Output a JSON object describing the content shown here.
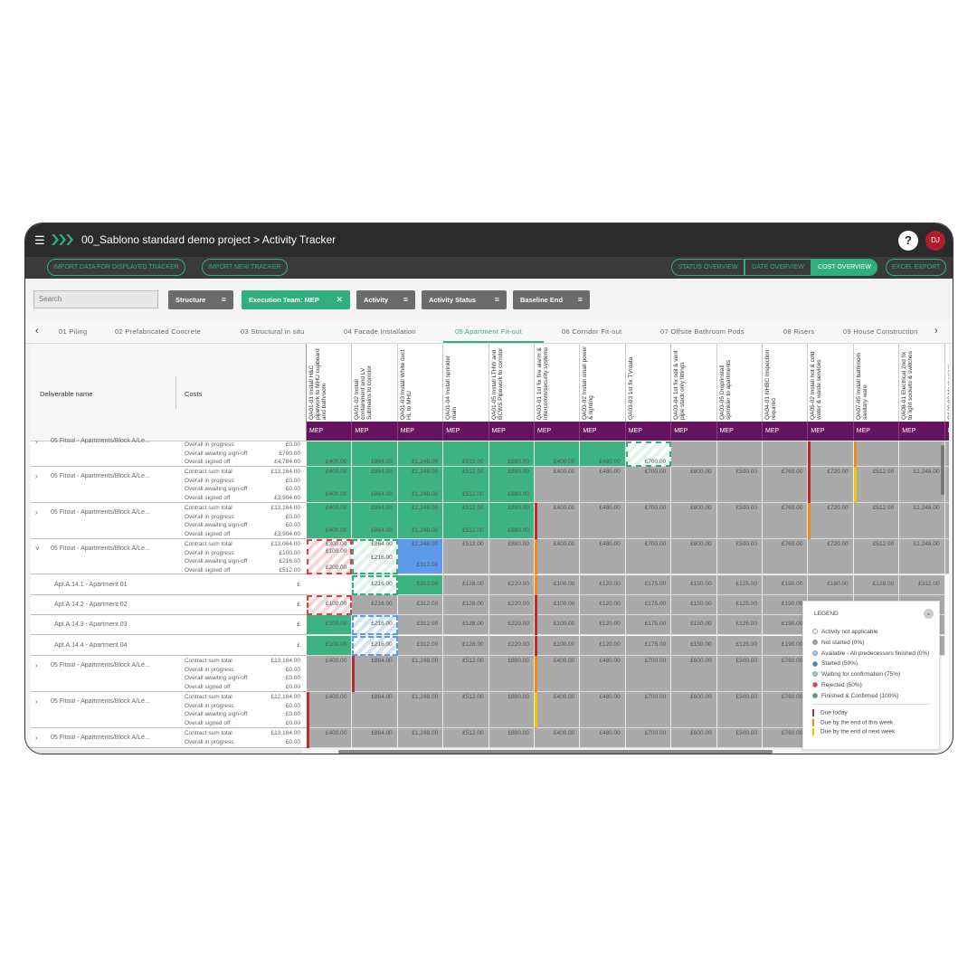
{
  "app": {
    "title": "00_Sablono standard demo project > Activity Tracker",
    "help_label": "?",
    "avatar_initials": "DJ"
  },
  "actions": {
    "import_displayed": "IMPORT DATA FOR DISPLAYED TRACKER",
    "import_new": "IMPORT NEW TRACKER",
    "status_overview": "STATUS OVERVIEW",
    "date_overview": "DATE OVERVIEW",
    "cost_overview": "COST OVERVIEW",
    "excel_export": "EXCEL EXPORT"
  },
  "search": {
    "placeholder": "Search"
  },
  "filters": [
    {
      "label": "Structure",
      "active": false
    },
    {
      "label": "Execution Team: MEP",
      "active": true
    },
    {
      "label": "Activity",
      "active": false
    },
    {
      "label": "Activity Status",
      "active": false
    },
    {
      "label": "Baseline End",
      "active": false
    }
  ],
  "tabs": [
    "01 Piling",
    "02 Prefabricated Concrete",
    "03 Structural in situ",
    "04 Facade Installation",
    "05 Apartment Fit-out",
    "06 Corridor Fit-out",
    "07 Offsite Bathroom Pods",
    "08 Risers",
    "09 House Construction"
  ],
  "active_tab": "05 Apartment Fit-out",
  "grid": {
    "col_deliverable": "Deliverable name",
    "col_costs": "Costs",
    "team": "MEP",
    "columns": [
      "QA01-01 Install H&C pipework to MHU cupboard and bathroom",
      "QA01-02 Install containment and LV Submains to corridor",
      "QA01-03 Install White duct HL to MHU",
      "QA01-04 Install sprinkler main",
      "QA01-05 Install LTHW and BCWS Pipework to corridor",
      "QA03-01 1st fix fire alarm & intercomm/security systems",
      "QA03-02 Install small power & lighting",
      "QA03-03 1st fix TV/data",
      "QA03-04 1st fix soil & vent pipe stack only fittings",
      "QA03-05 Drop/install sprinkler to apartments",
      "QA04-01 NHBC inspection required",
      "QA05-02 Install hot & cold water & waste services",
      "QA07-05 Install bathroom sanitary ware",
      "QA08-01 Electrical 2nd fix to light sockets & switches",
      "QA08-02 Mechanical"
    ],
    "rows": [
      {
        "name": "05 Fitout - Apartments/Block A/Le...",
        "costs": [
          [
            "Overall in progress",
            "£0.00"
          ],
          [
            "Overall awaiting sign-off",
            "£700.00"
          ],
          [
            "Overall signed off",
            "£4,784.00"
          ]
        ],
        "cells": [
          "£400.00",
          "£864.00",
          "£1,248.00",
          "£512.00",
          "£880.00",
          "£400.00",
          "£480.00",
          "£700.00",
          "",
          "",
          "",
          "",
          "",
          "",
          ""
        ]
      },
      {
        "name": "05 Fitout - Apartments/Block A/Le...",
        "costs": [
          [
            "Contract sum total",
            "£13,164.00"
          ],
          [
            "Overall in progress",
            "£0.00"
          ],
          [
            "Overall awaiting sign-off",
            "£0.00"
          ],
          [
            "Overall signed off",
            "£3,904.00"
          ]
        ],
        "cells": [
          "£400.00",
          "£864.00",
          "£1,248.00",
          "£512.00",
          "£880.00",
          "£400.00",
          "£480.00",
          "£700.00",
          "£600.00",
          "£500.00",
          "£760.00",
          "£720.00",
          "£512.00",
          "£1,248.00",
          ""
        ],
        "bottom": [
          "£400.00",
          "£864.00",
          "£1,248.00",
          "£512.00",
          "£880.00"
        ]
      },
      {
        "name": "05 Fitout - Apartments/Block A/Le...",
        "costs": [
          [
            "Contract sum total",
            "£13,164.00"
          ],
          [
            "Overall in progress",
            "£0.00"
          ],
          [
            "Overall awaiting sign-off",
            "£0.00"
          ],
          [
            "Overall signed off",
            "£3,904.00"
          ]
        ],
        "cells": [
          "£400.00",
          "£864.00",
          "£1,248.00",
          "£512.00",
          "£880.00",
          "£400.00",
          "£480.00",
          "£700.00",
          "£600.00",
          "£500.00",
          "£760.00",
          "£720.00",
          "£512.00",
          "£1,248.00",
          ""
        ],
        "bottom": [
          "£400.00",
          "£864.00",
          "£1,248.00",
          "£512.00",
          "£880.00"
        ]
      },
      {
        "name": "05 Fitout - Apartments/Block A/Le...",
        "costs": [
          [
            "Contract sum total",
            "£13,064.00"
          ],
          [
            "Overall in progress",
            "£100.00"
          ],
          [
            "Overall awaiting sign-off",
            "£216.00"
          ],
          [
            "Overall signed off",
            "£512.00"
          ]
        ],
        "cells": [
          "£300.00",
          "£864.00",
          "£1,248.00",
          "£512.00",
          "£880.00",
          "£400.00",
          "£480.00",
          "£700.00",
          "£600.00",
          "£500.00",
          "£760.00",
          "£720.00",
          "£512.00",
          "£1,248.00",
          ""
        ],
        "extra": {
          "c0a": "£100.00",
          "c0b": "£200.00",
          "c1a": "£216.00",
          "c2b": "£312.00"
        }
      }
    ],
    "apartments": [
      {
        "name": "Apt.A.14.1 - Apartment 01",
        "cells": [
          "",
          "£216.00",
          "£312.00",
          "£128.00",
          "£220.00",
          "£100.00",
          "£120.00",
          "£175.00",
          "£150.00",
          "£125.00",
          "£190.00",
          "£180.00",
          "£128.00",
          "£312.00"
        ]
      },
      {
        "name": "Apt.A.14.2 - Apartment 02",
        "cells": [
          "£100.00",
          "£216.00",
          "£312.00",
          "£128.00",
          "£220.00",
          "£100.00",
          "£120.00",
          "£175.00",
          "£150.00",
          "£125.00",
          "£190.00",
          "",
          "",
          ""
        ]
      },
      {
        "name": "Apt.A.14.3 - Apartment 03",
        "cells": [
          "£100.00",
          "£216.00",
          "£312.00",
          "£128.00",
          "£220.00",
          "£100.00",
          "£120.00",
          "£175.00",
          "£150.00",
          "£125.00",
          "£190.00",
          "",
          "",
          ""
        ]
      },
      {
        "name": "Apt.A.14.4 - Apartment 04",
        "cells": [
          "£100.00",
          "£216.00",
          "£312.00",
          "£128.00",
          "£220.00",
          "£100.00",
          "£120.00",
          "£175.00",
          "£150.00",
          "£125.00",
          "£190.00",
          "",
          "",
          ""
        ]
      }
    ],
    "apt_currency": "£",
    "rows2": [
      {
        "name": "05 Fitout - Apartments/Block A/Le...",
        "costs": [
          [
            "Contract sum total",
            "£13,164.00"
          ],
          [
            "Overall in progress",
            "£0.00"
          ],
          [
            "Overall awaiting sign-off",
            "£0.00"
          ],
          [
            "Overall signed off",
            "£0.00"
          ]
        ],
        "cells": [
          "£400.00",
          "£864.00",
          "£1,248.00",
          "£512.00",
          "£880.00",
          "£400.00",
          "£480.00",
          "£700.00",
          "£600.00",
          "£500.00",
          "£760.00"
        ]
      },
      {
        "name": "05 Fitout - Apartments/Block A/Le...",
        "costs": [
          [
            "Contract sum total",
            "£12,164.00"
          ],
          [
            "Overall in progress",
            "£0.00"
          ],
          [
            "Overall awaiting sign-off",
            "£0.00"
          ],
          [
            "Overall signed off",
            "£0.00"
          ]
        ],
        "cells": [
          "£400.00",
          "£864.00",
          "£1,248.00",
          "£512.00",
          "£880.00",
          "£400.00",
          "£480.00",
          "£700.00",
          "£600.00",
          "£500.00",
          "£760.00"
        ]
      },
      {
        "name": "05 Fitout - Apartments/Block A/Le...",
        "costs": [
          [
            "Contract sum total",
            "£13,164.00"
          ],
          [
            "Overall in progress",
            "£0.00"
          ]
        ],
        "cells": [
          "£400.00",
          "£864.00",
          "£1,248.00",
          "£512.00",
          "£880.00",
          "£400.00",
          "£480.00",
          "£700.00",
          "£600.00",
          "£500.00",
          "£760.00"
        ]
      }
    ]
  },
  "legend": {
    "title": "LEGEND",
    "items": [
      {
        "label": "Activity not applicable",
        "color": "#ffffff"
      },
      {
        "label": "Not started  (0%)",
        "color": "#9e9e9e"
      },
      {
        "label": "Available - All predecessors finished  (0%)",
        "color": "#a9c8f0"
      },
      {
        "label": "Started  (50%)",
        "color": "#3b82e0"
      },
      {
        "label": "Waiting for confirmation  (75%)",
        "color": "#8fd4b8"
      },
      {
        "label": "Rejected  (50%)",
        "color": "#e04040"
      },
      {
        "label": "Finished & Confirmed  (100%)",
        "color": "#2fae7f"
      }
    ],
    "due": [
      {
        "label": "Due today",
        "color": "#c62828"
      },
      {
        "label": "Due by the end of this week",
        "color": "#ef8a1a"
      },
      {
        "label": "Due by the end of next week",
        "color": "#f2c200"
      }
    ]
  }
}
